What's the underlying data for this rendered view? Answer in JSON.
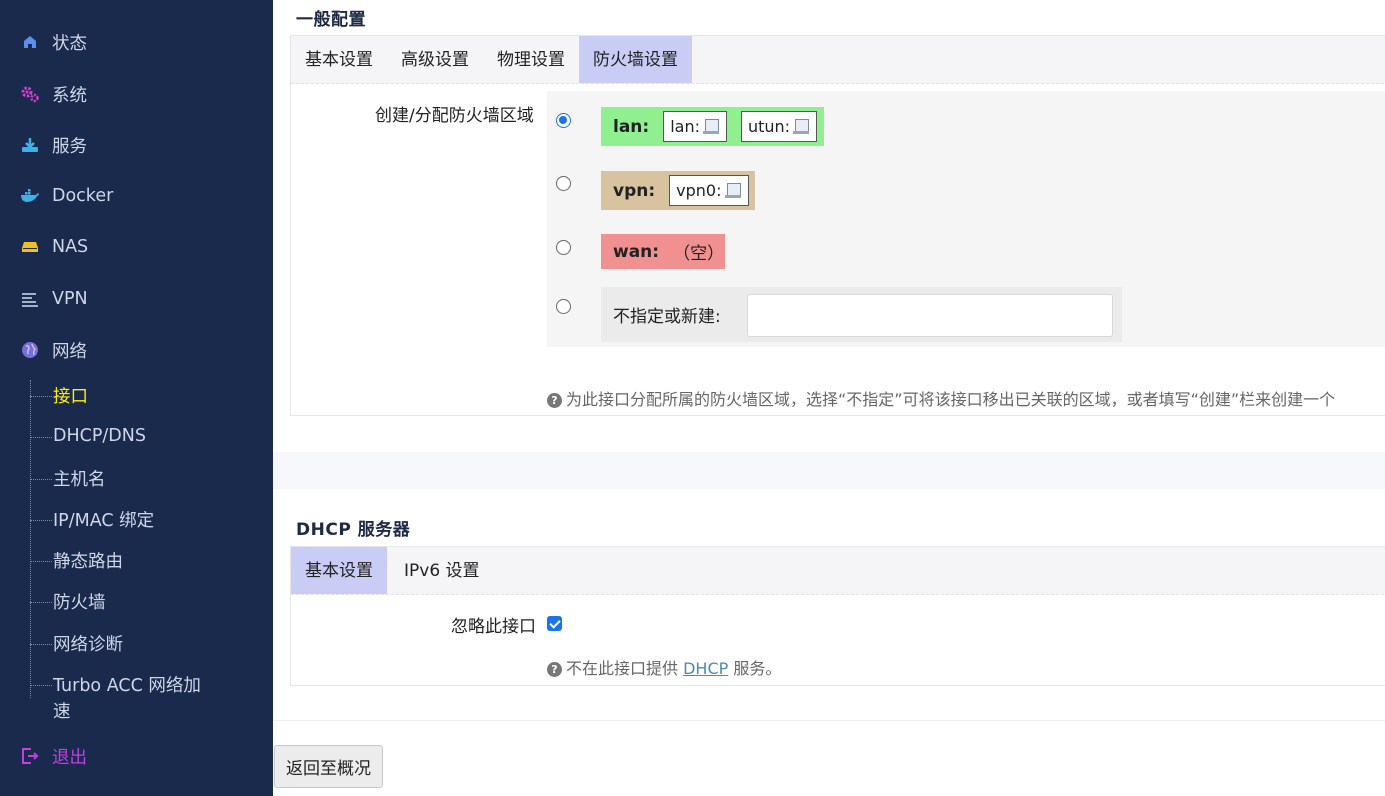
{
  "sidebar": {
    "items": [
      {
        "label": "状态",
        "icon": "home-icon"
      },
      {
        "label": "系统",
        "icon": "gears-icon"
      },
      {
        "label": "服务",
        "icon": "download-tray-icon"
      },
      {
        "label": "Docker",
        "icon": "docker-whale-icon"
      },
      {
        "label": "NAS",
        "icon": "hard-drive-icon"
      },
      {
        "label": "VPN",
        "icon": "list-lines-icon"
      },
      {
        "label": "网络",
        "icon": "globe-icon"
      }
    ],
    "network_subitems": [
      "接口",
      "DHCP/DNS",
      "主机名",
      "IP/MAC 绑定",
      "静态路由",
      "防火墙",
      "网络诊断",
      "Turbo ACC 网络加",
      "速"
    ],
    "logout": {
      "label": "退出",
      "icon": "logout-icon"
    },
    "accent_active": "#ffee00",
    "logout_color": "#c040e0",
    "background": "#1a2a4c"
  },
  "general": {
    "title": "一般配置",
    "tabs": [
      "基本设置",
      "高级设置",
      "物理设置",
      "防火墙设置"
    ],
    "active_tab": "防火墙设置",
    "field_label": "创建/分配防火墙区域",
    "zones": [
      {
        "name": "lan:",
        "color": "#90f090",
        "ifaces": [
          "lan:",
          "utun:"
        ],
        "selected": true
      },
      {
        "name": "vpn:",
        "color": "#d8c3a1",
        "ifaces": [
          "vpn0:"
        ],
        "selected": false
      },
      {
        "name": "wan:",
        "color": "#f09090",
        "empty": "（空）",
        "selected": false
      }
    ],
    "new_zone_label": "不指定或新建:",
    "new_zone_value": "",
    "help": "为此接口分配所属的防火墙区域，选择“不指定”可将该接口移出已关联的区域，或者填写“创建”栏来创建一个"
  },
  "dhcp": {
    "title": "DHCP 服务器",
    "tabs": [
      "基本设置",
      "IPv6 设置"
    ],
    "active_tab": "基本设置",
    "ignore_label": "忽略此接口",
    "ignore_checked": true,
    "help_prefix": "不在此接口提供",
    "help_link": "DHCP",
    "help_suffix": "服务。"
  },
  "back_button": "返回至概况"
}
